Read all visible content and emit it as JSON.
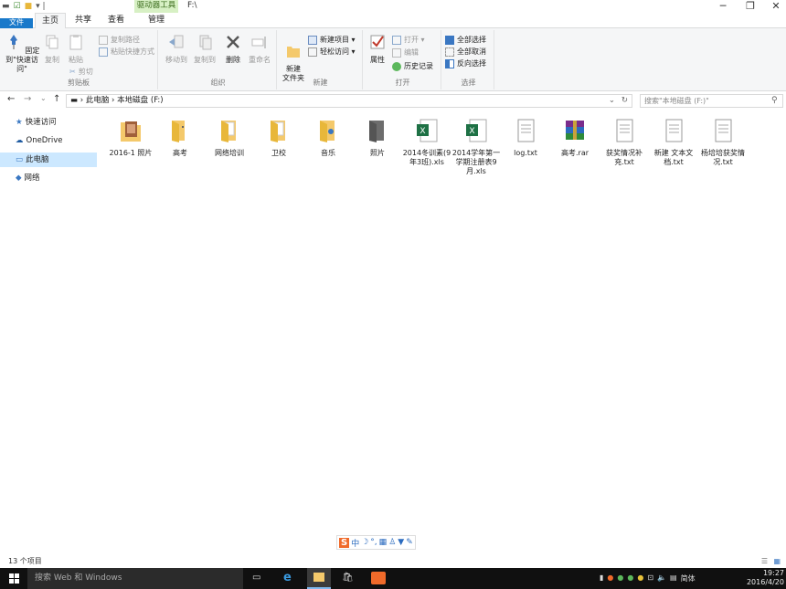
{
  "window": {
    "title": "F:\\",
    "context_tab": "驱动器工具"
  },
  "tabs": [
    {
      "label": "文件"
    },
    {
      "label": "主页"
    },
    {
      "label": "共享"
    },
    {
      "label": "查看"
    },
    {
      "label": "管理"
    }
  ],
  "ribbon": {
    "clipboard": {
      "pin": "固定到\"快速访问\"",
      "copy": "复制",
      "paste": "粘贴",
      "copy_path": "复制路径",
      "paste_shortcut": "粘贴快捷方式",
      "cut": "剪切",
      "label": "剪贴板"
    },
    "organize": {
      "move_to": "移动到",
      "copy_to": "复制到",
      "delete": "删除",
      "rename": "重命名",
      "label": "组织"
    },
    "new": {
      "new_folder": "新建\n文件夹",
      "new_item": "新建项目 ▾",
      "easy_access": "轻松访问 ▾",
      "label": "新建"
    },
    "open": {
      "properties": "属性",
      "open": "打开 ▾",
      "edit": "编辑",
      "history": "历史记录",
      "label": "打开"
    },
    "select": {
      "select_all": "全部选择",
      "select_none": "全部取消",
      "invert": "反向选择",
      "label": "选择"
    }
  },
  "address": {
    "path_1": "此电脑",
    "path_2": "本地磁盘 (F:)",
    "search_placeholder": "搜索\"本地磁盘 (F:)\""
  },
  "sidebar": {
    "items": [
      {
        "label": "快速访问"
      },
      {
        "label": "OneDrive"
      },
      {
        "label": "此电脑"
      },
      {
        "label": "网络"
      }
    ]
  },
  "files": [
    {
      "name": "2016-1 照片"
    },
    {
      "name": "高考"
    },
    {
      "name": "网络培训"
    },
    {
      "name": "卫校"
    },
    {
      "name": "音乐"
    },
    {
      "name": "照片"
    },
    {
      "name": "2014冬训素(9年3班).xls"
    },
    {
      "name": "2014学年第一学期注册表9月.xls"
    },
    {
      "name": "log.txt"
    },
    {
      "name": "高考.rar"
    },
    {
      "name": "获奖情况补充.txt"
    },
    {
      "name": "新建 文本文档.txt"
    },
    {
      "name": "杨培培获奖情况.txt"
    }
  ],
  "status": {
    "count": "13 个项目"
  },
  "taskbar": {
    "search": "搜索 Web 和 Windows",
    "time": "19:27",
    "date": "2016/4/20",
    "ime": "简体"
  },
  "colors": {
    "accent": "#1979ca",
    "context_tab": "#d7f0c4",
    "selection": "#cce8ff",
    "folder": "#f4c96b"
  }
}
